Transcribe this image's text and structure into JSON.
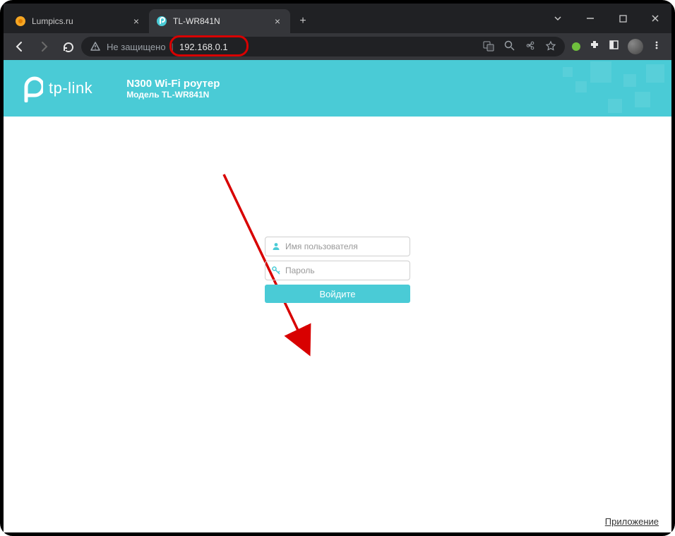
{
  "browser": {
    "tabs": [
      {
        "title": "Lumpics.ru",
        "active": false
      },
      {
        "title": "TL-WR841N",
        "active": true
      }
    ],
    "security_label": "Не защищено",
    "url": "192.168.0.1"
  },
  "header": {
    "brand": "tp-link",
    "product_title": "N300 Wi-Fi роутер",
    "product_model": "Модель TL-WR841N"
  },
  "login": {
    "username_placeholder": "Имя пользователя",
    "password_placeholder": "Пароль",
    "submit_label": "Войдите"
  },
  "footer": {
    "app_link": "Приложение"
  }
}
